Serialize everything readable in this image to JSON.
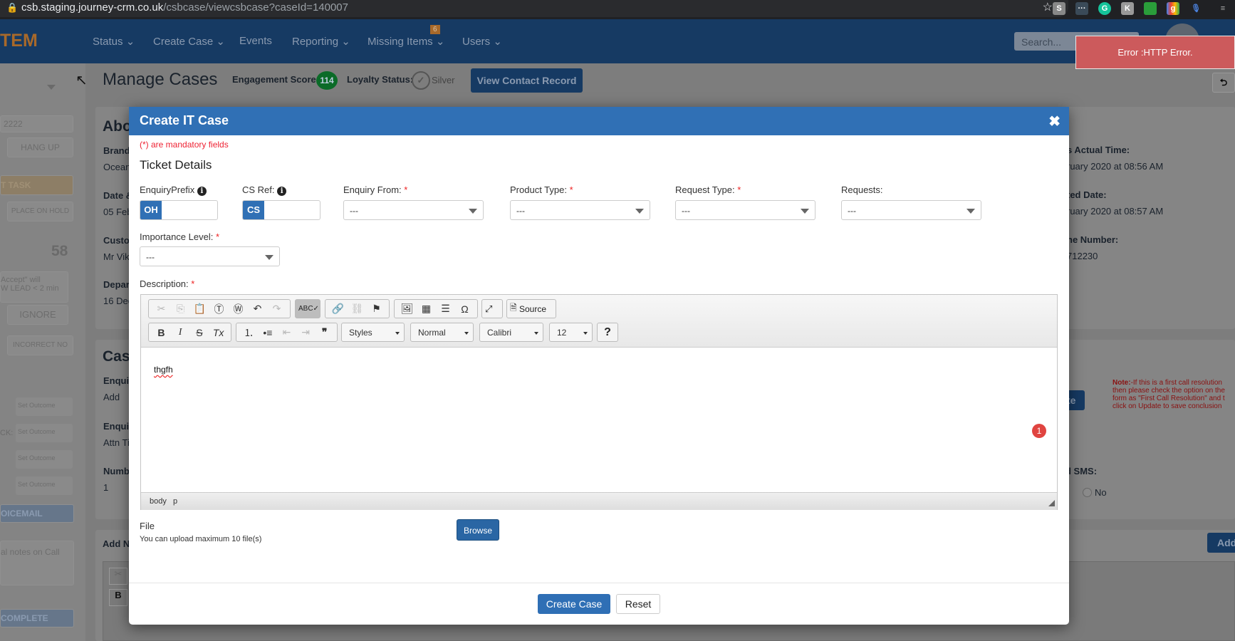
{
  "browser": {
    "url_host": "csb.staging.journey-crm.co.uk",
    "url_path": "/csbcase/viewcsbcase?caseId=140007",
    "extensions": [
      "skype-icon",
      "more-icon",
      "grammarly-icon",
      "k-icon",
      "avg-icon",
      "google-icon",
      "mic-icon",
      "media-icon"
    ]
  },
  "nav": {
    "logo": "TEM",
    "items": [
      {
        "label": "Status ⌄"
      },
      {
        "label": "Create Case ⌄"
      },
      {
        "label": "Events"
      },
      {
        "label": "Reporting ⌄"
      },
      {
        "label": "Missing Items ⌄"
      },
      {
        "label": "Users ⌄"
      }
    ],
    "missing_items_badge": "6",
    "search_placeholder": "Search..."
  },
  "toast": {
    "message": "Error :HTTP Error.",
    "color": "#cc5a5c"
  },
  "page_header": {
    "title": "Manage Cases",
    "engagement_label": "Engagement Score:",
    "engagement_score": "114",
    "loyalty_label": "Loyalty Status:",
    "loyalty_value": "Silver",
    "view_contact_button": "View Contact Record"
  },
  "sidebar": {
    "extension": "2222",
    "hang_up": "HANG UP",
    "task": "T TASK",
    "hold": "PLACE ON HOLD",
    "count": "58",
    "accept_note_1": "Accept\" will",
    "accept_note_2": "W LEAD < 2 min",
    "ignore": "IGNORE",
    "incorrect": "INCORRECT NO",
    "callback_label": "CK:",
    "outcome": "Set Outcome",
    "voicemail": "OICEMAIL",
    "notes_placeholder": "al notes on Call",
    "complete": "COMPLETE"
  },
  "background": {
    "about_title": "Abo",
    "brand_label": "Brand:",
    "brand_value": "Ocean",
    "date_label": "Date &",
    "date_value": "05 Feb",
    "customer_label": "Custo",
    "customer_value": "Mr Vik",
    "depart_label": "Depart",
    "depart_value": "16 Dec",
    "case_title": "Case",
    "enq_label": "Enquir",
    "enq_value": "Add",
    "enq2_label": "Enquir",
    "enq2_value": "Attn Ti",
    "num_label": "Numb",
    "num_value": "1",
    "addnote_label": "Add N",
    "actual_time_label": "s Actual Time:",
    "actual_time_value": "ruary 2020 at 08:56 AM",
    "created_label": "ted Date:",
    "created_value": "ruary 2020 at 08:57 AM",
    "phone_label": "ne Number:",
    "phone_value": "712230",
    "update_button": "te",
    "note_bold": "Note:",
    "note_lines": [
      "-If this is a first call resolution",
      "then please check the option on the",
      "form as \"First Call Resolution\" and t",
      "click on Update to save conclusion"
    ],
    "sms_label": "d SMS:",
    "sms_no": "No",
    "add_button": "Add"
  },
  "modal": {
    "title": "Create IT Case",
    "mandatory_note": "(*) are mandatory fields",
    "section": "Ticket Details",
    "fields": {
      "enquiry_prefix": {
        "label": "EnquiryPrefix",
        "prefix": "OH",
        "value": ""
      },
      "cs_ref": {
        "label": "CS Ref:",
        "prefix": "CS",
        "value": ""
      },
      "enquiry_from": {
        "label": "Enquiry From:",
        "value": "---"
      },
      "product_type": {
        "label": "Product Type:",
        "value": "---"
      },
      "request_type": {
        "label": "Request Type:",
        "value": "---"
      },
      "requests": {
        "label": "Requests:",
        "value": "---"
      },
      "importance": {
        "label": "Importance Level:",
        "value": "---"
      },
      "description": {
        "label": "Description:",
        "value": "thgfh"
      }
    },
    "editor": {
      "source_label": "Source",
      "styles": "Styles",
      "format": "Normal",
      "font": "Calibri",
      "size": "12",
      "help": "?",
      "status_path": [
        "body",
        "p"
      ],
      "counter": "1"
    },
    "file": {
      "label": "File",
      "hint": "You can upload maximum 10 file(s)",
      "browse": "Browse"
    },
    "create_button": "Create Case",
    "reset_button": "Reset"
  }
}
